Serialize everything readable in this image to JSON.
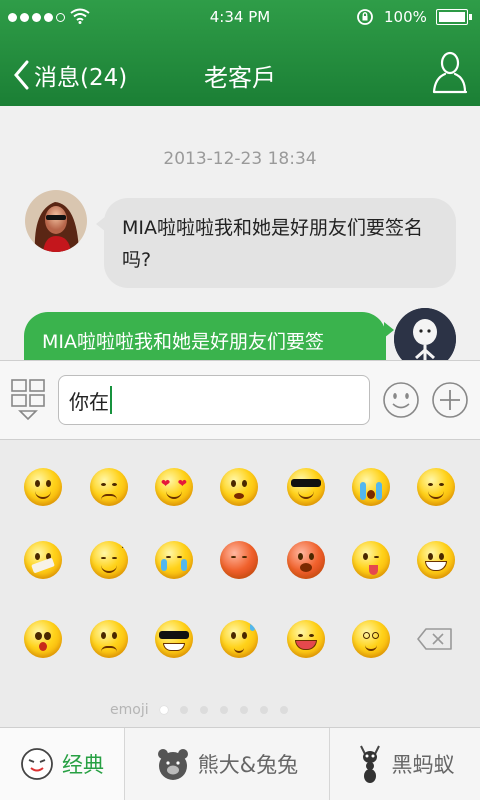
{
  "status_bar": {
    "time": "4:34 PM",
    "battery": "100%"
  },
  "nav": {
    "back_label": "消息(24)",
    "title": "老客戶"
  },
  "chat": {
    "timestamp": "2013-12-23 18:34",
    "messages": [
      {
        "direction": "incoming",
        "text": "MIA啦啦啦我和她是好朋友们要签名吗?"
      },
      {
        "direction": "outgoing",
        "text": "MIA啦啦啦我和她是好朋友们要签"
      }
    ]
  },
  "input": {
    "value": "你在"
  },
  "emoji_panel": {
    "label": "emoji",
    "page_count": 7,
    "current_page": 1,
    "emojis": [
      "smile",
      "shy",
      "heart-eyes",
      "angry",
      "cool",
      "crying",
      "laughing",
      "silenced",
      "sleepy",
      "crying-tears",
      "sad",
      "angry-red",
      "tongue",
      "grin",
      "scared",
      "frown",
      "sunglasses",
      "sweat",
      "grin-laugh",
      "dizzy"
    ]
  },
  "tabs": [
    {
      "label": "经典",
      "icon": "classic-emoji-icon",
      "active": true
    },
    {
      "label": "熊大&兔兔",
      "icon": "bear-icon",
      "active": false
    },
    {
      "label": "黑蚂蚁",
      "icon": "ant-icon",
      "active": false
    }
  ],
  "colors": {
    "header_green": "#1f8a3a",
    "outgoing_bubble": "#3ab34d",
    "incoming_bubble": "#e3e3e3",
    "active_tab": "#27a043"
  }
}
